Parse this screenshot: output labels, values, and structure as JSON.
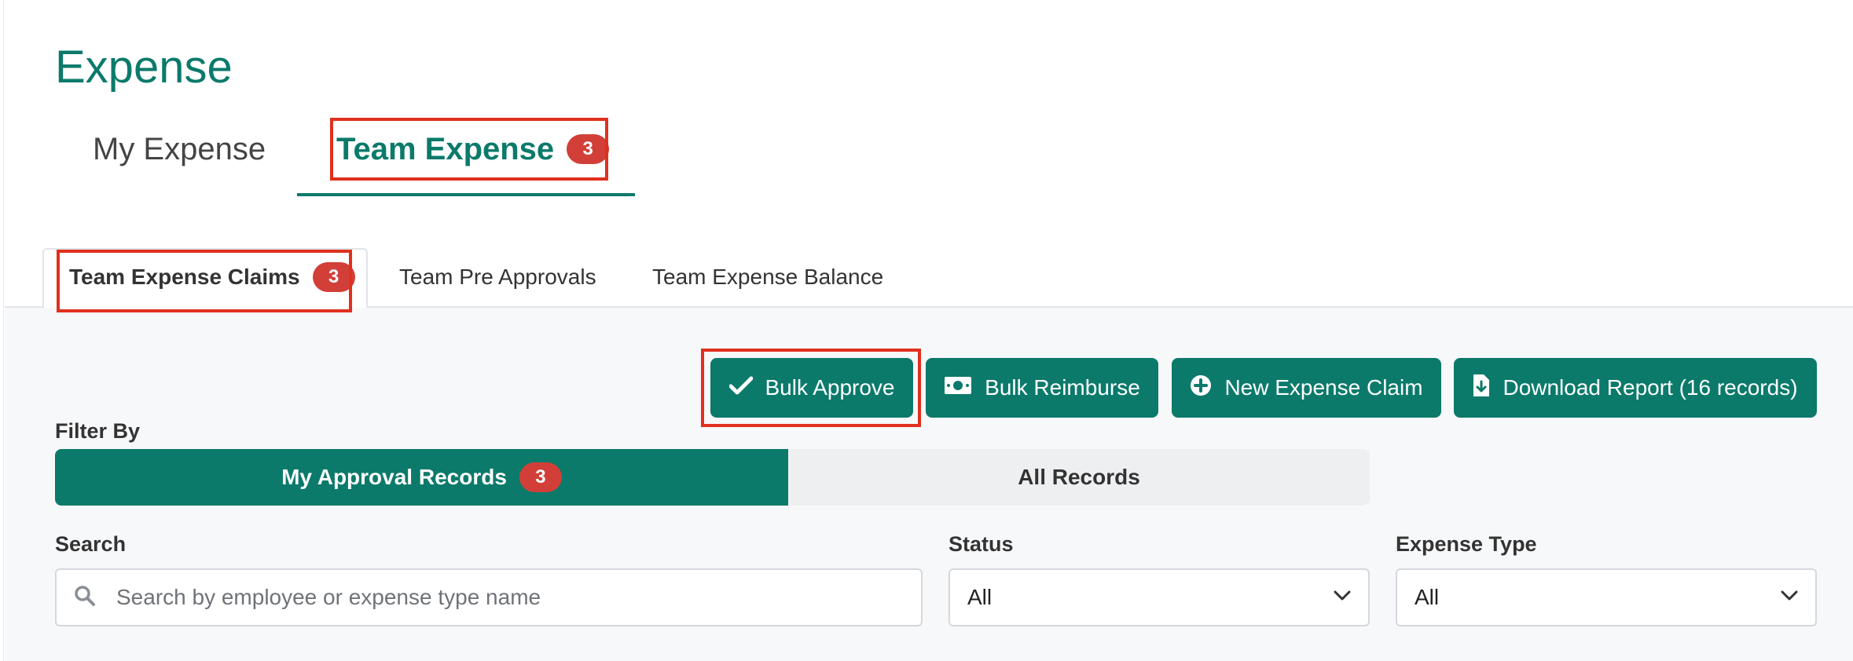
{
  "page": {
    "title": "Expense"
  },
  "top_tabs": {
    "my_expense": "My Expense",
    "team_expense": "Team Expense",
    "team_expense_badge": "3"
  },
  "sub_tabs": {
    "claims": "Team Expense Claims",
    "claims_badge": "3",
    "pre_approvals": "Team Pre Approvals",
    "balance": "Team Expense Balance"
  },
  "actions": {
    "bulk_approve": "Bulk Approve",
    "bulk_reimburse": "Bulk Reimburse",
    "new_claim": "New Expense Claim",
    "download_report": "Download Report (16 records)"
  },
  "filter": {
    "label": "Filter By",
    "my_approval": "My Approval Records",
    "my_approval_badge": "3",
    "all_records": "All Records"
  },
  "search": {
    "label": "Search",
    "placeholder": "Search by employee or expense type name"
  },
  "status": {
    "label": "Status",
    "value": "All"
  },
  "expense_type": {
    "label": "Expense Type",
    "value": "All"
  },
  "colors": {
    "accent": "#0b7a6b",
    "badge": "#d23f38",
    "highlight": "#e0301e"
  },
  "icons": [
    "check-icon",
    "cash-icon",
    "plus-circle-icon",
    "file-download-icon",
    "search-icon",
    "chevron-down-icon"
  ]
}
